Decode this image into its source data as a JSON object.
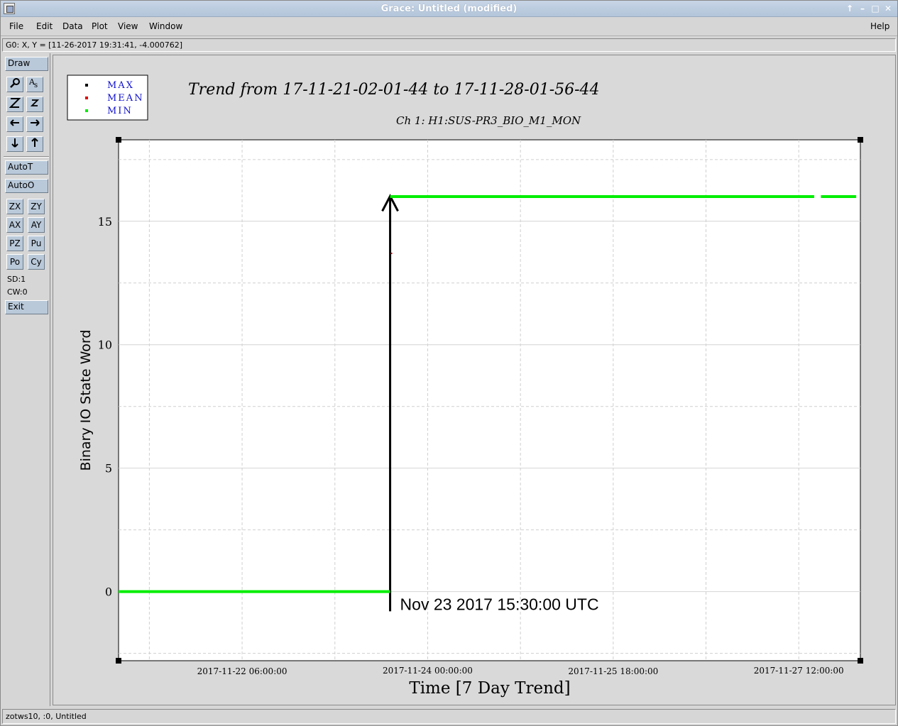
{
  "window": {
    "title": "Grace: Untitled (modified)",
    "controls": [
      "↑",
      "–",
      "□",
      "✕"
    ]
  },
  "menu": {
    "file": "File",
    "edit": "Edit",
    "data": "Data",
    "plot": "Plot",
    "view": "View",
    "window": "Window",
    "help": "Help"
  },
  "locator": "G0: X, Y = [11-26-2017 19:31:41, -4.000762]",
  "toolbar": {
    "draw": "Draw",
    "autoT": "AutoT",
    "autoO": "AutoO",
    "zx": "ZX",
    "zy": "ZY",
    "ax": "AX",
    "ay": "AY",
    "pz": "PZ",
    "pu": "Pu",
    "po": "Po",
    "cy": "Cy",
    "sd": "SD:1",
    "cw": "CW:0",
    "exit": "Exit",
    "icons": [
      "zoom-icon",
      "autoscale-text-icon",
      "zoom-in-icon",
      "zoom-out-icon",
      "scroll-left-icon",
      "scroll-right-icon",
      "scroll-down-icon",
      "scroll-up-icon"
    ]
  },
  "statusbar": "zotws10, :0, Untitled",
  "chart_data": {
    "type": "line",
    "title": "Trend from 17-11-21-02-01-44 to 17-11-28-01-56-44",
    "subtitle": "Ch 1: H1:SUS-PR3_BIO_M1_MON",
    "xlabel": "Time [7 Day Trend]",
    "ylabel": "Binary IO State Word",
    "xlim": [
      "2017-11-21 02:01:44",
      "2017-11-28 01:56:44"
    ],
    "ylim": [
      -2.8,
      18.3
    ],
    "xticks": [
      "2017-11-22 06:00:00",
      "2017-11-24 00:00:00",
      "2017-11-25 18:00:00",
      "2017-11-27 12:00:00"
    ],
    "yticks": [
      0,
      5,
      10,
      15
    ],
    "grid": true,
    "legend": {
      "placement": "top-left",
      "entries": [
        "MAX",
        "MEAN",
        "MIN"
      ]
    },
    "colors": {
      "MAX": "#000000",
      "MEAN": "#dd0000",
      "MIN": "#00ee00"
    },
    "series": [
      {
        "name": "MIN",
        "segments": [
          {
            "x": [
              "2017-11-21 02:01:44",
              "2017-11-23 15:30:00"
            ],
            "y": [
              0,
              0
            ]
          },
          {
            "x": [
              "2017-11-23 15:30:00",
              "2017-11-27 15:30:00"
            ],
            "y": [
              16,
              16
            ]
          },
          {
            "x": [
              "2017-11-27 17:00:00",
              "2017-11-28 01:00:00"
            ],
            "y": [
              16,
              16
            ]
          }
        ]
      },
      {
        "name": "MEAN",
        "segments": [
          {
            "x": [
              "2017-11-23 15:30:00"
            ],
            "y": [
              13.7
            ]
          }
        ]
      }
    ],
    "annotation": {
      "text": "Nov 23 2017 15:30:00 UTC",
      "x": "2017-11-23 15:30:00",
      "arrow_from_y": -0.8,
      "arrow_to_y": 15.5
    }
  }
}
